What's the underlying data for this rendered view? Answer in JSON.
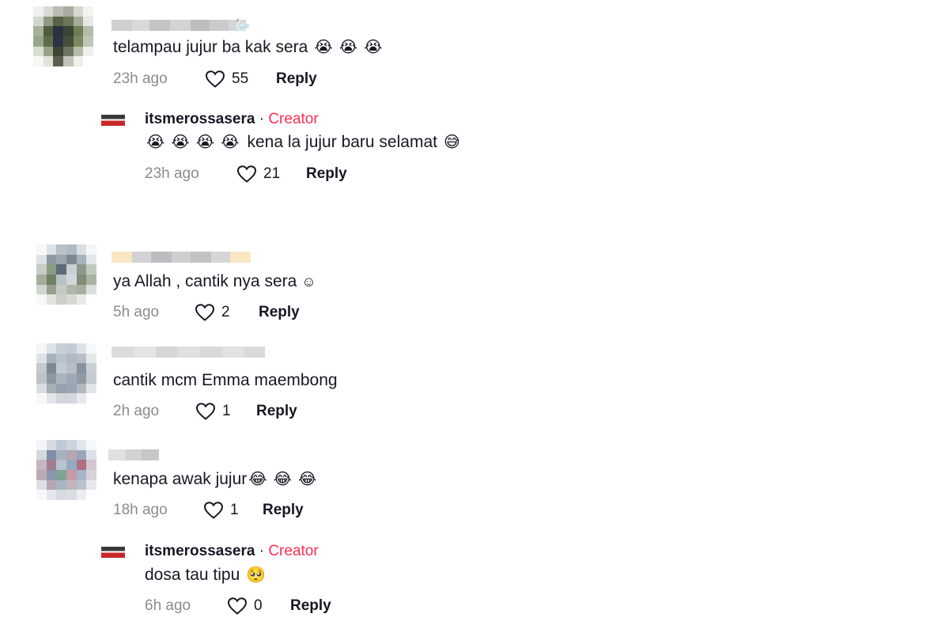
{
  "comments": [
    {
      "text": "telampau jujur ba kak sera",
      "emojis": [
        "😭",
        "😭",
        "😭"
      ],
      "name_suffix_icon": "🦢",
      "time": "23h ago",
      "likes": "55",
      "reply_label": "Reply",
      "replies": [
        {
          "username": "itsmerossasera",
          "separator": "·",
          "badge": "Creator",
          "lead_emojis": [
            "😭",
            "😭",
            "😭",
            "😭"
          ],
          "text": "kena la jujur baru selamat",
          "trail_emojis": [
            "😅"
          ],
          "time": "23h ago",
          "likes": "21",
          "reply_label": "Reply"
        }
      ]
    },
    {
      "text": "ya Allah , cantik nya sera",
      "trail_symbol": "☺",
      "time": "5h ago",
      "likes": "2",
      "reply_label": "Reply"
    },
    {
      "text": "cantik mcm Emma maembong",
      "time": "2h ago",
      "likes": "1",
      "reply_label": "Reply"
    },
    {
      "text": "kenapa awak jujur",
      "emojis": [
        "😂",
        "😂",
        "😂"
      ],
      "time": "18h ago",
      "likes": "1",
      "reply_label": "Reply",
      "replies": [
        {
          "username": "itsmerossasera",
          "separator": "·",
          "badge": "Creator",
          "text": "dosa tau tipu",
          "trail_emojis": [
            "🥺"
          ],
          "time": "6h ago",
          "likes": "0",
          "reply_label": "Reply"
        }
      ]
    }
  ],
  "icons": {
    "like": "heart-outline-icon"
  },
  "colors": {
    "creator_badge": "#fe2c55",
    "time": "#8a8b91",
    "text": "#161823"
  }
}
